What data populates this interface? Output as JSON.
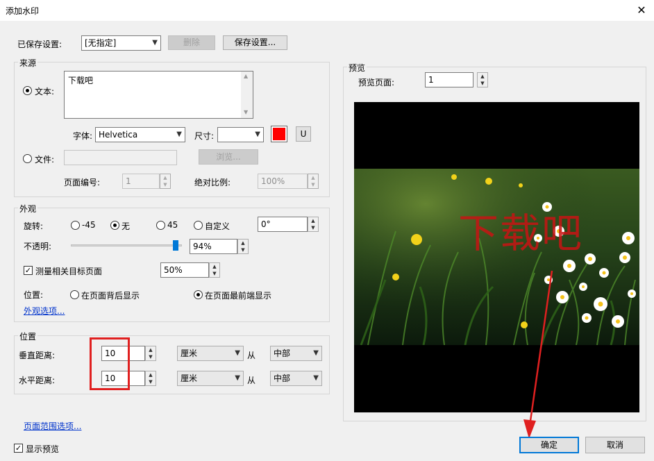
{
  "window": {
    "title": "添加水印"
  },
  "saved_settings": {
    "label": "已保存设置:",
    "value": "[无指定]",
    "delete_label": "删除",
    "save_label": "保存设置..."
  },
  "source": {
    "group_label": "来源",
    "text_radio": "文本:",
    "text_value": "下载吧",
    "font_label": "字体:",
    "font_value": "Helvetica",
    "size_label": "尺寸:",
    "size_value": "",
    "color": "#ff0000",
    "underline_label": "U",
    "file_radio": "文件:",
    "file_value": "",
    "browse_label": "浏览...",
    "page_number_label": "页面编号:",
    "page_number_value": "1",
    "scale_label": "绝对比例:",
    "scale_value": "100%"
  },
  "appearance": {
    "group_label": "外观",
    "rotation_label": "旋转:",
    "rot_neg45": "-45",
    "rot_none": "无",
    "rot_45": "45",
    "rot_custom": "自定义",
    "rot_custom_value": "0°",
    "opacity_label": "不透明:",
    "opacity_value": "94%",
    "opacity_level": 0.94,
    "scale_check_label": "测量相关目标页面",
    "scale_value": "50%",
    "position_label": "位置:",
    "pos_behind": "在页面背后显示",
    "pos_front": "在页面最前端显示",
    "options_link": "外观选项..."
  },
  "position": {
    "group_label": "位置",
    "vertical_label": "垂直距离:",
    "vertical_value": "10",
    "vertical_unit": "厘米",
    "vertical_from_label": "从",
    "vertical_from": "中部",
    "horizontal_label": "水平距离:",
    "horizontal_value": "10",
    "horizontal_unit": "厘米",
    "horizontal_from_label": "从",
    "horizontal_from": "中部"
  },
  "page_range_link": "页面范围选项...",
  "show_preview_label": "显示预览",
  "preview": {
    "group_label": "预览",
    "page_label": "预览页面:",
    "page_value": "1",
    "watermark_text": "下载吧"
  },
  "buttons": {
    "ok": "确定",
    "cancel": "取消"
  },
  "colors": {
    "highlight_box": "#e02020",
    "arrow": "#e02020",
    "default_button_border": "#0078d7"
  }
}
